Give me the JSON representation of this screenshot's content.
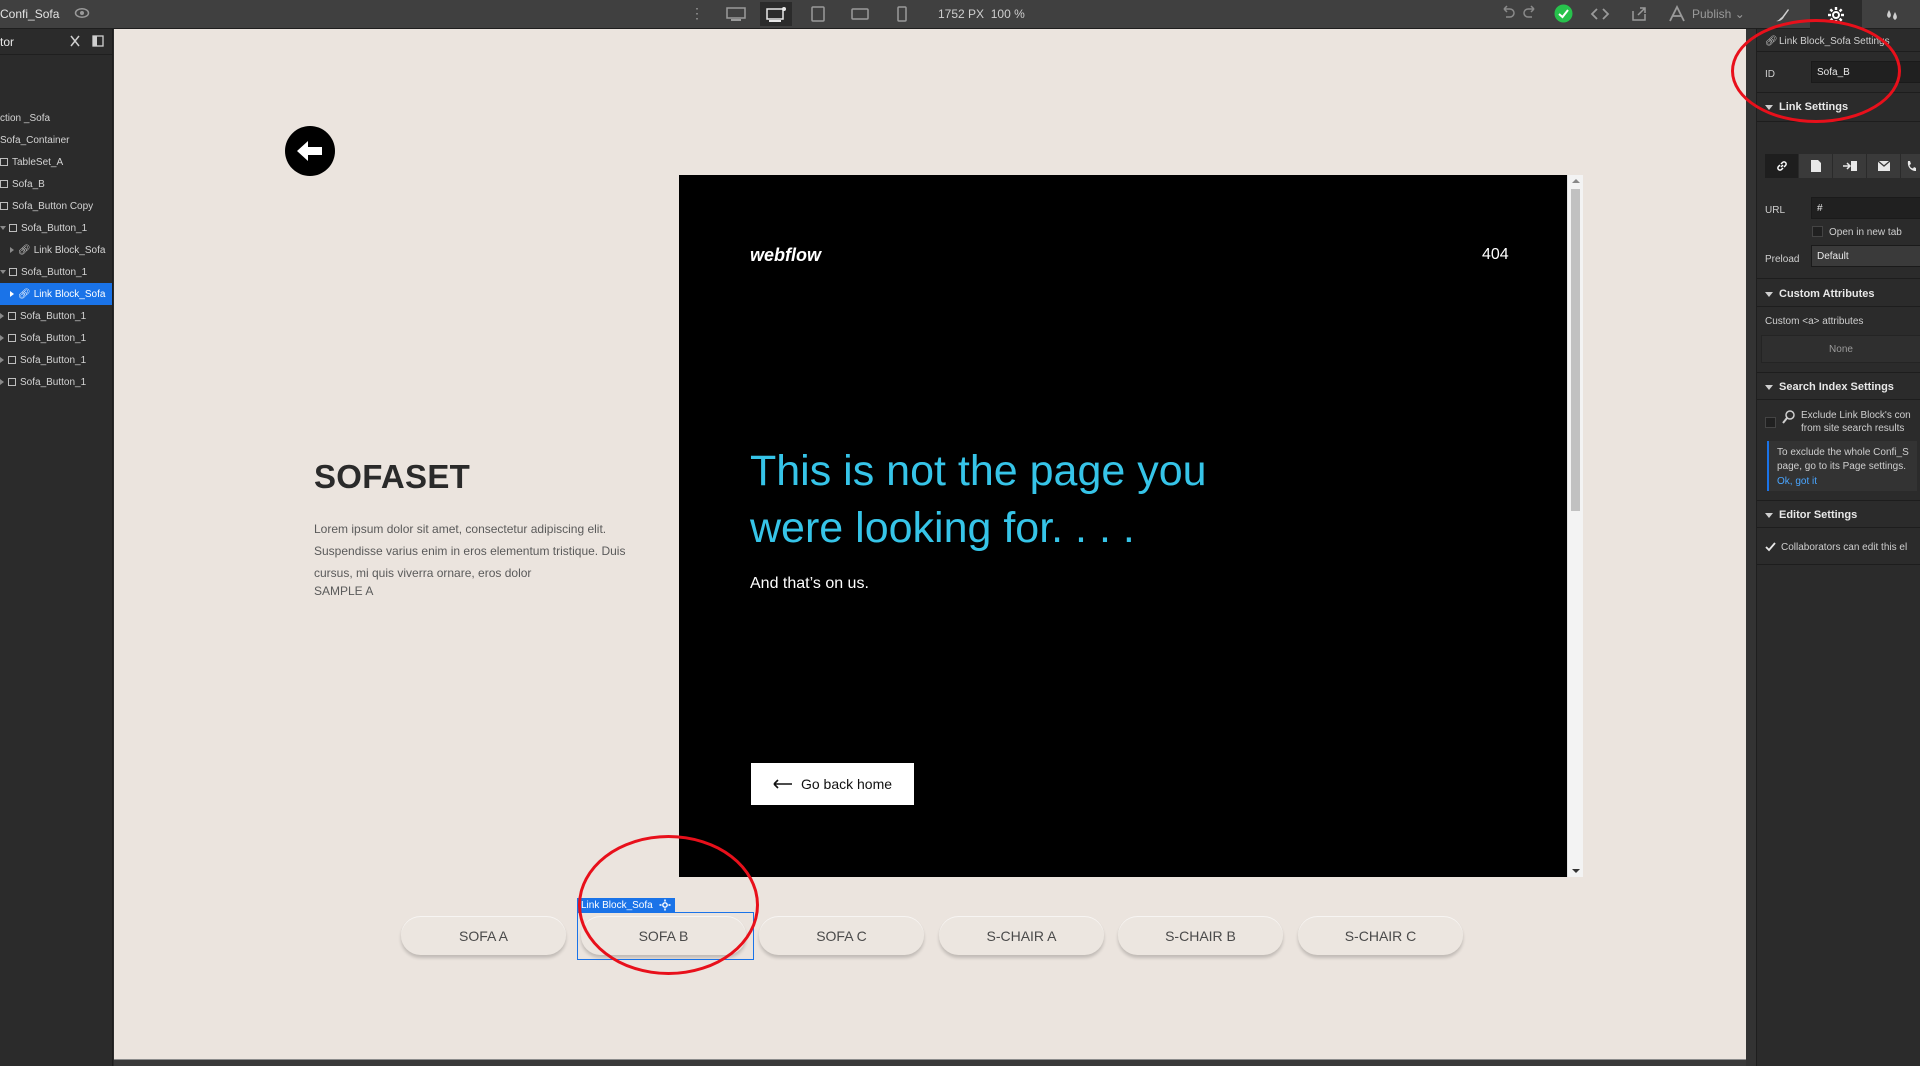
{
  "topbar": {
    "page_name": "Confi_Sofa",
    "canvas_width": "1752 PX",
    "zoom": "100 %",
    "publish_label": "Publish",
    "status_color": "#27c24c"
  },
  "navigator": {
    "title": "tor",
    "items": [
      {
        "label": "ction _Sofa",
        "kind": "section"
      },
      {
        "label": "Sofa_Container",
        "kind": "container"
      },
      {
        "label": "TableSet_A",
        "kind": "box"
      },
      {
        "label": "Sofa_B",
        "kind": "box"
      },
      {
        "label": "Sofa_Button Copy",
        "kind": "box"
      },
      {
        "label": "Sofa_Button_1",
        "kind": "box"
      },
      {
        "label": "Link Block_Sofa",
        "kind": "link"
      },
      {
        "label": "Sofa_Button_1",
        "kind": "box"
      },
      {
        "label": "Link Block_Sofa",
        "kind": "link",
        "selected": true
      },
      {
        "label": "Sofa_Button_1",
        "kind": "box"
      },
      {
        "label": "Sofa_Button_1",
        "kind": "box"
      },
      {
        "label": "Sofa_Button_1",
        "kind": "box"
      },
      {
        "label": "Sofa_Button_1",
        "kind": "box"
      }
    ]
  },
  "canvas": {
    "heading": "SOFASET",
    "description": "Lorem ipsum dolor sit amet, consectetur adipiscing elit. Suspendisse varius enim in eros elementum tristique. Duis cursus, mi quis viverra ornare, eros dolor",
    "sample": "SAMPLE A",
    "embed": {
      "logo": "webflow",
      "code": "404",
      "headline": "This is not the page you were looking for. . . .",
      "subtext": "And that’s on us.",
      "button": "Go back home",
      "headline_color": "#36c4e8"
    },
    "selection_tag": "Link Block_Sofa",
    "buttons": [
      "SOFA A",
      "SOFA B",
      "SOFA C",
      "S-CHAIR A",
      "S-CHAIR B",
      "S-CHAIR C"
    ]
  },
  "panel": {
    "element_title": "Link Block_Sofa Settings",
    "id_label": "ID",
    "id_value": "Sofa_B",
    "link_settings": "Link Settings",
    "url_label": "URL",
    "url_value": "#",
    "new_tab": "Open in new tab",
    "preload_label": "Preload",
    "preload_value": "Default",
    "custom_attributes": "Custom Attributes",
    "custom_a": "Custom <a> attributes",
    "none": "None",
    "search_index": "Search Index Settings",
    "exclude_text": "Exclude Link Block's con from site search results",
    "info_text": "To exclude the whole Confi_S page, go to its Page settings.",
    "info_link": "Ok, got it",
    "editor_settings": "Editor Settings",
    "collab_text": "Collaborators can edit this el"
  },
  "colors": {
    "accent": "#1a73e8",
    "annotation": "#e8101b",
    "canvas_bg": "#ebe4de"
  }
}
